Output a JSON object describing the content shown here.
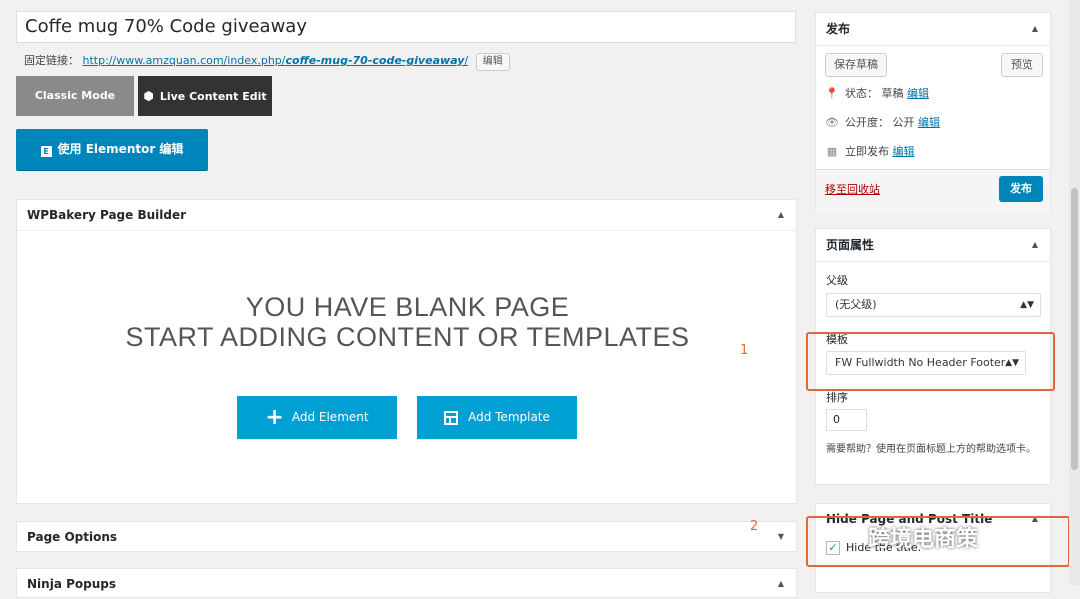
{
  "post": {
    "title": "Coffe mug 70% Code  giveaway",
    "permalink_label": "固定链接：",
    "permalink_base": "http://www.amzquan.com/index.php/",
    "permalink_slug": "coffe-mug-70-code-giveaway",
    "permalink_trailing": "/",
    "permalink_edit": "编辑"
  },
  "editor_modes": {
    "classic": "Classic Mode",
    "live": "Live Content Edit",
    "elementor": "使用 Elementor 编辑"
  },
  "wpbakery": {
    "title": "WPBakery Page Builder",
    "blank_line1": "YOU HAVE BLANK PAGE",
    "blank_line2": "START ADDING CONTENT OR TEMPLATES",
    "add_element": "Add Element",
    "add_template": "Add Template"
  },
  "page_options": {
    "title": "Page Options"
  },
  "ninja_popups": {
    "title": "Ninja Popups"
  },
  "annotations": {
    "one": "1",
    "two": "2"
  },
  "publish": {
    "title": "发布",
    "save_draft": "保存草稿",
    "preview": "预览",
    "status_label": "状态：",
    "status_value": "草稿",
    "visibility_label": "公开度：",
    "visibility_value": "公开",
    "schedule_label": "立即发布",
    "edit": "编辑",
    "trash": "移至回收站",
    "publish_button": "发布"
  },
  "page_attributes": {
    "title": "页面属性",
    "parent_label": "父级",
    "parent_value": "(无父级)",
    "template_label": "模板",
    "template_value": "FW Fullwidth No Header Footer",
    "order_label": "排序",
    "order_value": "0",
    "help_text": "需要帮助？使用在页面标题上方的帮助选项卡。"
  },
  "hide_title": {
    "title": "Hide Page and Post Title",
    "checkbox_label": "Hide the title.",
    "checked": true
  },
  "watermark": "跨境电商策",
  "colors": {
    "primary_blue": "#0085ba",
    "builder_blue": "#00a0d2",
    "highlight": "#e8633a",
    "trash_red": "#a00"
  }
}
